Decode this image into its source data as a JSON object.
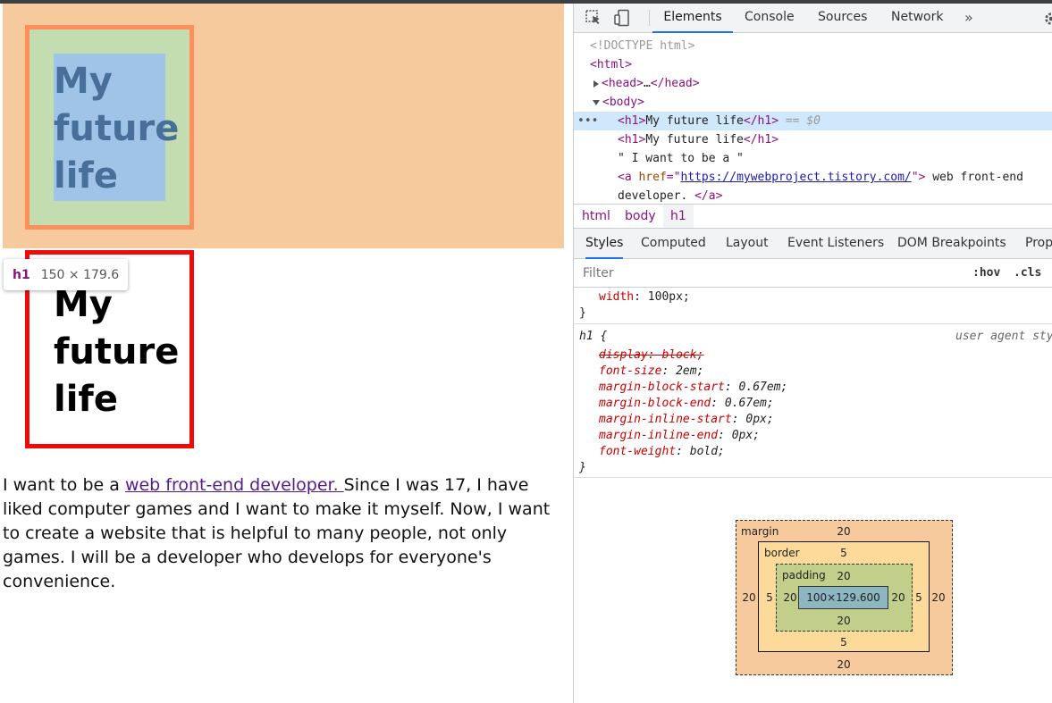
{
  "page": {
    "heading_line1": "My",
    "heading_line2": "future",
    "heading_line3": "life",
    "tooltip": {
      "tag": "h1",
      "size": "150 × 179.6"
    },
    "paragraph_before_link": "I want to be a ",
    "link_text": "web front-end developer. ",
    "paragraph_after_link": "Since I was 17, I have liked computer games and I want to make it myself. Now, I want to create a website that is helpful to many people, not only games. I will be a developer who develops for everyone's convenience."
  },
  "devtools": {
    "tabs": [
      "Elements",
      "Console",
      "Sources",
      "Network"
    ],
    "active_tab": "Elements",
    "more_tabs": "»",
    "icons": {
      "inspect": "inspect-element-icon",
      "device": "device-toolbar-icon",
      "settings": "gear-icon"
    },
    "elements_tree": {
      "doctype": "<!DOCTYPE html>",
      "html_open": "<html>",
      "head_open": "<head>",
      "head_ellipsis": "…",
      "head_close": "</head>",
      "body_open": "<body>",
      "selected_dots": "•••",
      "h1_open": "<h1>",
      "h1_text": "My future life",
      "h1_close": "</h1>",
      "selected_marker": "== $0",
      "text_node": "\" I want to be a \"",
      "a_open_start": "<a ",
      "a_attr_name": "href",
      "a_attr_eq": "=\"",
      "a_attr_value": "https://mywebproject.tistory.com/",
      "a_attr_end": "\">",
      "a_text_start": " web front-end",
      "a_text_cont": "developer. ",
      "a_close": "</a>"
    },
    "breadcrumbs": [
      "html",
      "body",
      "h1"
    ],
    "styles_tabs": [
      "Styles",
      "Computed",
      "Layout",
      "Event Listeners",
      "DOM Breakpoints",
      "Prop"
    ],
    "active_styles_tab": "Styles",
    "filter": {
      "placeholder": "Filter",
      "value": ""
    },
    "hov": ":hov",
    "cls": ".cls",
    "prev_rule": {
      "prop": "width",
      "value": "100px;",
      "close": "}"
    },
    "ua_rule": {
      "selector": "h1 {",
      "source": "user agent stylesheet",
      "close": "}",
      "declarations": [
        {
          "prop": "display",
          "value": "block;",
          "struck": true
        },
        {
          "prop": "font-size",
          "value": "2em;",
          "struck": false
        },
        {
          "prop": "margin-block-start",
          "value": "0.67em;",
          "struck": false
        },
        {
          "prop": "margin-block-end",
          "value": "0.67em;",
          "struck": false
        },
        {
          "prop": "margin-inline-start",
          "value": "0px;",
          "struck": false
        },
        {
          "prop": "margin-inline-end",
          "value": "0px;",
          "struck": false
        },
        {
          "prop": "font-weight",
          "value": "bold;",
          "struck": false
        }
      ]
    },
    "box_model": {
      "margin_label": "margin",
      "border_label": "border",
      "padding_label": "padding",
      "margin": {
        "top": "20",
        "right": "20",
        "bottom": "20",
        "left": "20"
      },
      "border": {
        "top": "5",
        "right": "5",
        "bottom": "5",
        "left": "5"
      },
      "padding": {
        "top": "20",
        "right": "20",
        "bottom": "20",
        "left": "20"
      },
      "content": "100×129.600"
    }
  },
  "colors": {
    "margin_highlight": "#f6ca9c",
    "border_highlight": "#fc8f5b",
    "padding_highlight": "#c3ddb0",
    "content_highlight": "#a0c4e8",
    "h1_border": "#f00a0a",
    "devtools_accent": "#1a73e8",
    "tag_color": "#881280"
  }
}
